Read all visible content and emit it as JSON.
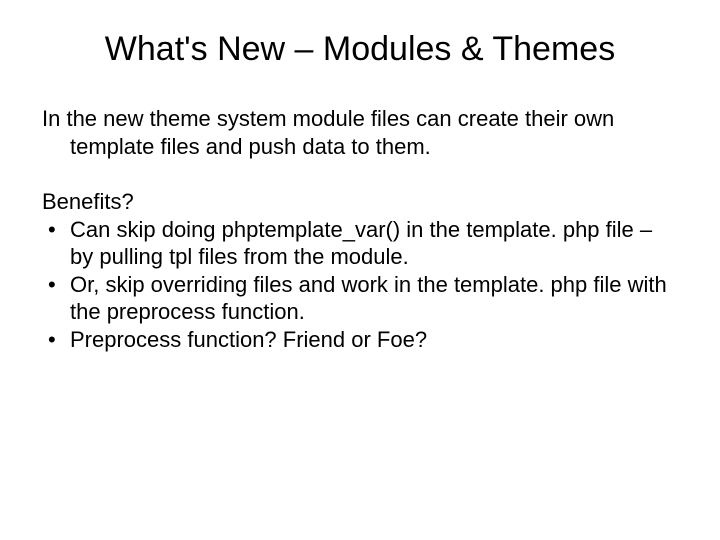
{
  "slide": {
    "title": "What's New – Modules & Themes",
    "intro": "In the new theme system module files can create their own template files and push data to them.",
    "benefits_label": "Benefits?",
    "bullets": [
      "Can skip doing phptemplate_var() in the template. php file – by pulling tpl files from the module.",
      "Or, skip overriding files and work in the template. php file with the preprocess function.",
      "Preprocess function? Friend or Foe?"
    ]
  }
}
